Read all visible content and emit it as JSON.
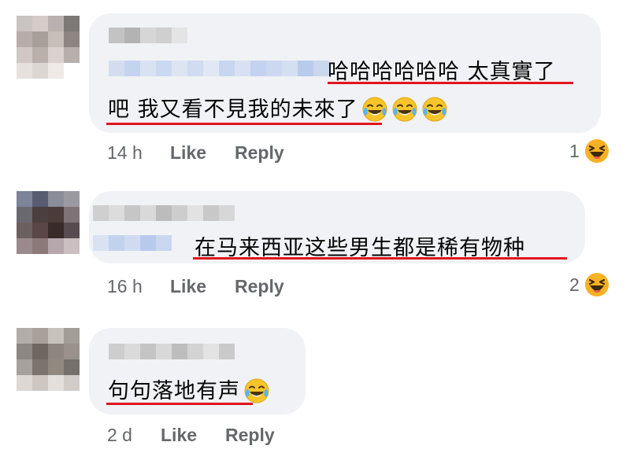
{
  "comments": [
    {
      "text_line1": "哈哈哈哈哈哈 太真實了",
      "text_line2": "吧 我又看不見我的未來了",
      "time": "14 h",
      "like_label": "Like",
      "reply_label": "Reply",
      "reaction_count": "1",
      "reaction_icon": "laughing-reaction-icon",
      "trailing_emoji": [
        "tears-of-joy-icon",
        "tears-of-joy-icon",
        "tears-of-joy-icon"
      ]
    },
    {
      "text_line1": "在马来西亚这些男生都是稀有物种",
      "time": "16 h",
      "like_label": "Like",
      "reply_label": "Reply",
      "reaction_count": "2",
      "reaction_icon": "laughing-reaction-icon"
    },
    {
      "text_line1": "句句落地有声",
      "time": "2 d",
      "like_label": "Like",
      "reply_label": "Reply",
      "trailing_emoji": [
        "tears-of-joy-icon"
      ]
    }
  ],
  "colors": {
    "bubble": "#f0f2f5",
    "underline": "#e0161d",
    "meta_text": "#65676b",
    "reaction_yellow": "#f7b125"
  }
}
